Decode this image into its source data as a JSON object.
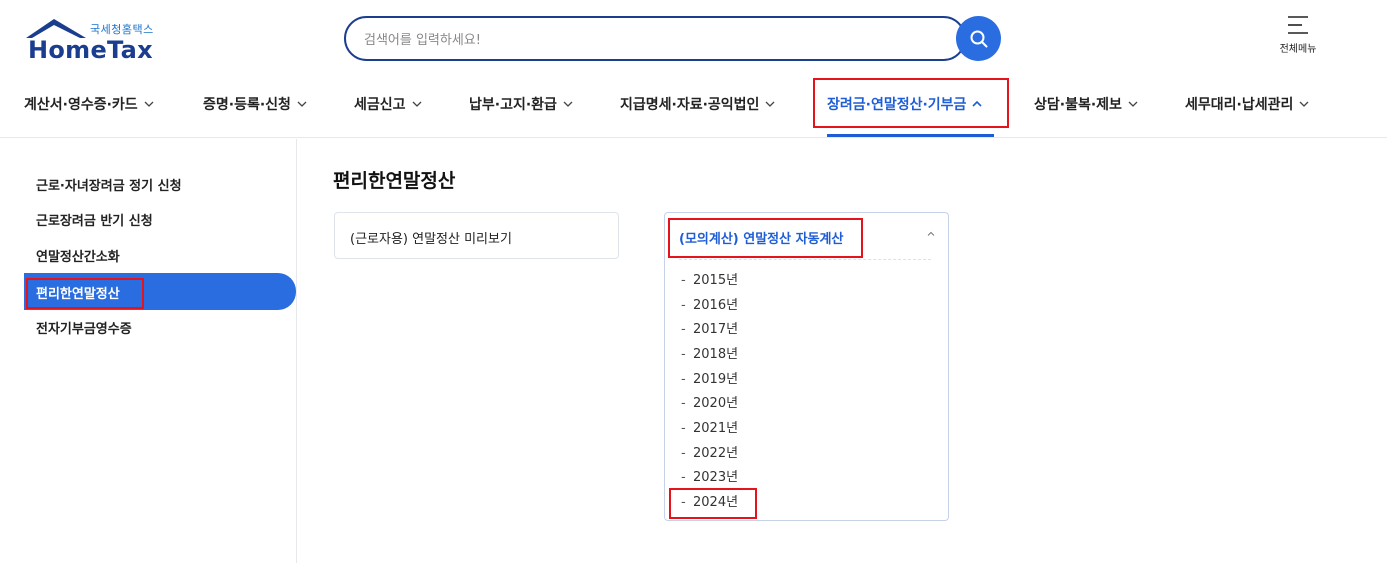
{
  "header": {
    "logo_sub": "국세청홈택스",
    "logo_main": "HomeTax",
    "search_placeholder": "검색어를 입력하세요!",
    "allmenu_label": "전체메뉴"
  },
  "gnb": {
    "items": [
      {
        "label": "계산서·영수증·카드"
      },
      {
        "label": "증명·등록·신청"
      },
      {
        "label": "세금신고"
      },
      {
        "label": "납부·고지·환급"
      },
      {
        "label": "지급명세·자료·공익법인"
      },
      {
        "label": "장려금·연말정산·기부금"
      },
      {
        "label": "상담·불복·제보"
      },
      {
        "label": "세무대리·납세관리"
      }
    ],
    "active_index": 5
  },
  "sidebar": {
    "items": [
      {
        "label": "근로·자녀장려금 정기 신청"
      },
      {
        "label": "근로장려금 반기 신청"
      },
      {
        "label": "연말정산간소화"
      },
      {
        "label": "편리한연말정산"
      },
      {
        "label": "전자기부금영수증"
      }
    ],
    "active_index": 3
  },
  "main": {
    "title": "편리한연말정산",
    "card_left": "(근로자용) 연말정산 미리보기",
    "card_right": {
      "label": "(모의계산) 연말정산 자동계산",
      "years": [
        "2015년",
        "2016년",
        "2017년",
        "2018년",
        "2019년",
        "2020년",
        "2021년",
        "2022년",
        "2023년",
        "2024년"
      ]
    }
  },
  "colors": {
    "accent": "#2a6de0",
    "active_text": "#1f5dd6",
    "highlight": "#e5141c",
    "logo_navy": "#1b3d8f"
  }
}
